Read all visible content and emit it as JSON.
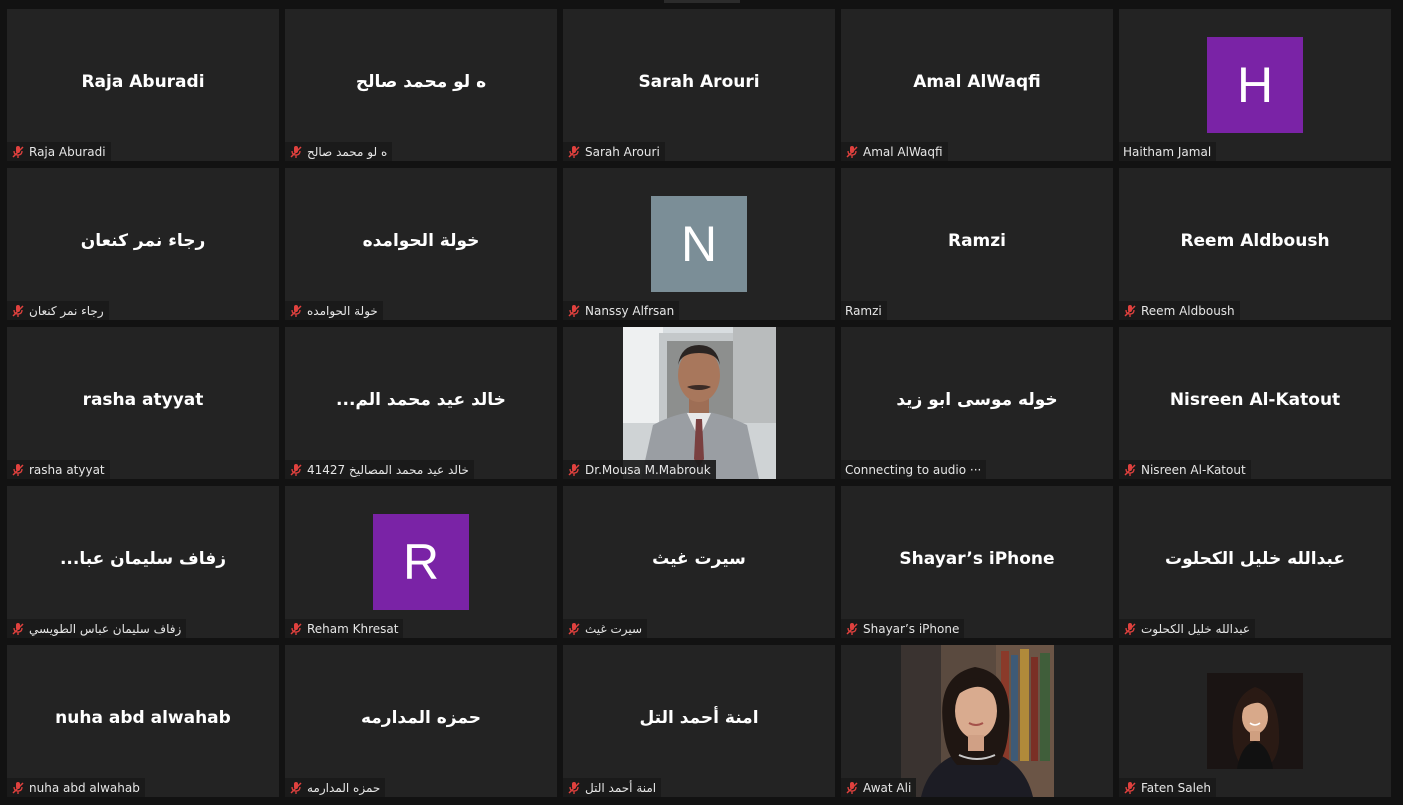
{
  "colors": {
    "background": "#121212",
    "tile": "#232323",
    "mute_red": "#e0413e",
    "avatar_purple": "#7a23a6",
    "avatar_slate": "#7b8e97"
  },
  "tiles": [
    {
      "name": "Raja Aburadi",
      "label": "Raja Aburadi",
      "muted": true
    },
    {
      "name": "ه لو محمد صالح",
      "label": "ه لو محمد صالح",
      "muted": true
    },
    {
      "name": "Sarah Arouri",
      "label": "Sarah Arouri",
      "muted": true
    },
    {
      "name": "Amal AlWaqfi",
      "label": "Amal AlWaqfi",
      "muted": true
    },
    {
      "avatar": "H",
      "label": "Haitham Jamal",
      "muted": false
    },
    {
      "name": "رجاء نمر كنعان",
      "label": "رجاء نمر كنعان",
      "muted": true
    },
    {
      "name": "خولة الحوامده",
      "label": "خولة الحوامده",
      "muted": true
    },
    {
      "avatar": "N",
      "label": "Nanssy Alfrsan",
      "muted": true
    },
    {
      "name": "Ramzi",
      "label": "Ramzi",
      "muted": false
    },
    {
      "name": "Reem Aldboush",
      "label": "Reem Aldboush",
      "muted": true
    },
    {
      "name": "rasha atyyat",
      "label": "rasha atyyat",
      "muted": true
    },
    {
      "name": "...خالد عيد محمد الم",
      "label": "خالد عيد محمد المصاليخ 41427",
      "muted": true
    },
    {
      "label": "Dr.Mousa M.Mabrouk",
      "muted": true
    },
    {
      "name": "خوله موسى ابو زيد",
      "label": "Connecting to audio ···",
      "muted": false
    },
    {
      "name": "Nisreen Al-Katout",
      "label": "Nisreen Al-Katout",
      "muted": true
    },
    {
      "name": "...زفاف سليمان عبا",
      "label": "زفاف سليمان عباس الطويسي",
      "muted": true
    },
    {
      "avatar": "R",
      "label": "Reham Khresat",
      "muted": true
    },
    {
      "name": "سيرت غيث",
      "label": "سيرت غيث",
      "muted": true
    },
    {
      "name": "Shayar’s iPhone",
      "label": "Shayar’s iPhone",
      "muted": true
    },
    {
      "name": "عبدالله خليل الكحلوت",
      "label": "عبدالله خليل الكحلوت",
      "muted": true
    },
    {
      "name": "nuha abd alwahab",
      "label": "nuha abd alwahab",
      "muted": true
    },
    {
      "name": "حمزه المدارمه",
      "label": "حمزه المدارمه",
      "muted": true
    },
    {
      "name": "امنة أحمد التل",
      "label": "امنة أحمد التل",
      "muted": true
    },
    {
      "label": "Awat Ali",
      "muted": true
    },
    {
      "label": "Faten Saleh",
      "muted": true
    }
  ]
}
